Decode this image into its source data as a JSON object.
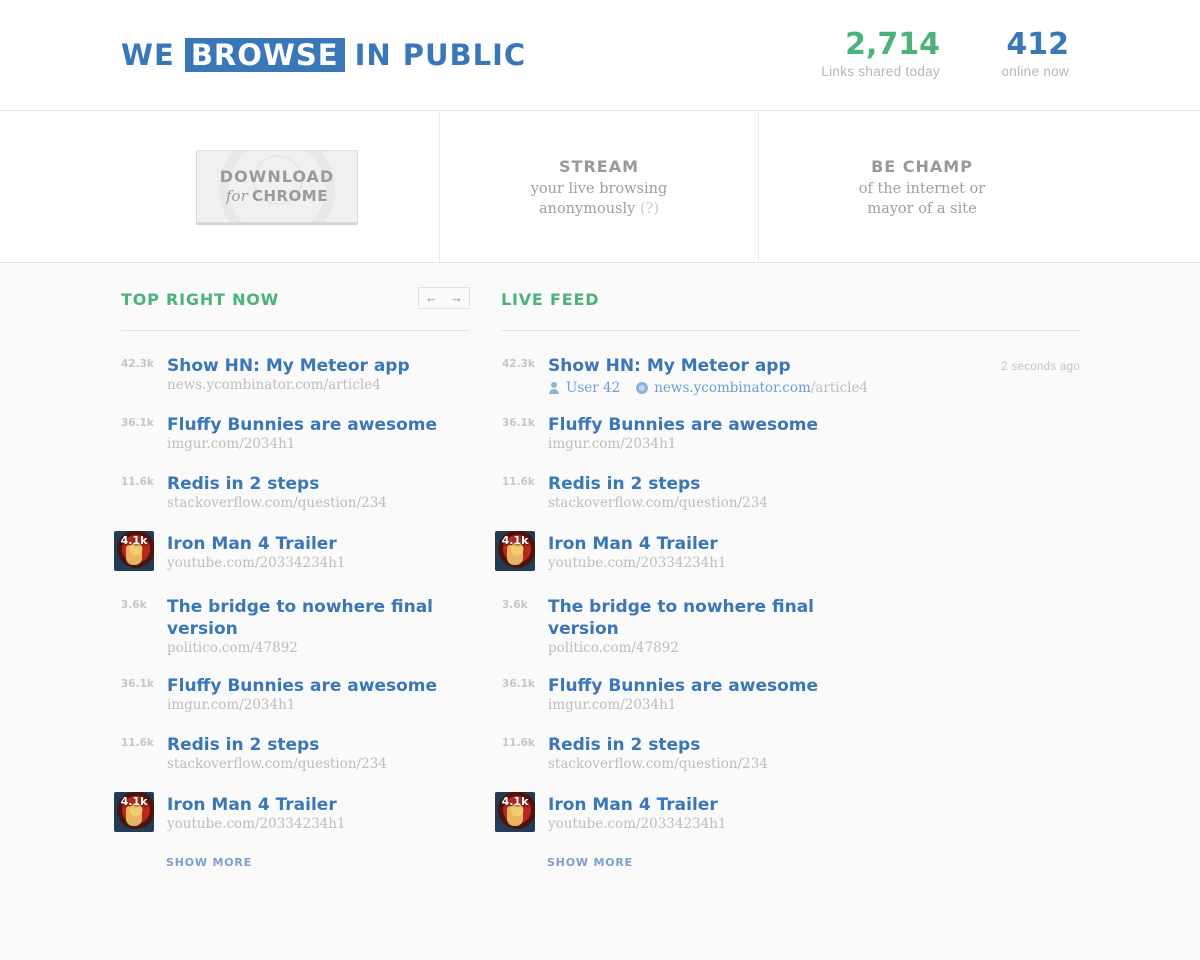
{
  "header": {
    "logo_pre": "WE",
    "logo_highlight": "BROWSE",
    "logo_post": "IN PUBLIC",
    "links_count": "2,714",
    "links_label": "Links shared today",
    "online_count": "412",
    "online_label": "online now"
  },
  "promo": {
    "download_line1": "DOWNLOAD",
    "download_for": "for",
    "download_chrome": "CHROME",
    "stream_title": "STREAM",
    "stream_line1": "your live browsing",
    "stream_line2": "anonymously",
    "stream_help": "(?)",
    "champ_title": "BE CHAMP",
    "champ_line1": "of the internet or",
    "champ_line2": "mayor of a site"
  },
  "top": {
    "title": "TOP RIGHT NOW",
    "prev_icon": "arrow-left-icon",
    "next_icon": "arrow-right-icon",
    "items": [
      {
        "count": "42.3k",
        "title": "Show HN: My Meteor app",
        "url": "news.ycombinator.com/article4",
        "thumb": false
      },
      {
        "count": "36.1k",
        "title": "Fluffy Bunnies are awesome",
        "url": "imgur.com/2034h1",
        "thumb": false
      },
      {
        "count": "11.6k",
        "title": "Redis in 2 steps",
        "url": "stackoverflow.com/question/234",
        "thumb": false
      },
      {
        "count": "4.1k",
        "title": "Iron Man 4 Trailer",
        "url": "youtube.com/20334234h1",
        "thumb": true
      },
      {
        "count": "3.6k",
        "title": "The bridge to nowhere final version",
        "url": "politico.com/47892",
        "thumb": false
      },
      {
        "count": "36.1k",
        "title": "Fluffy Bunnies are awesome",
        "url": "imgur.com/2034h1",
        "thumb": false
      },
      {
        "count": "11.6k",
        "title": "Redis in 2 steps",
        "url": "stackoverflow.com/question/234",
        "thumb": false
      },
      {
        "count": "4.1k",
        "title": "Iron Man 4 Trailer",
        "url": "youtube.com/20334234h1",
        "thumb": true
      }
    ],
    "show_more": "SHOW MORE"
  },
  "live": {
    "title": "LIVE FEED",
    "first_user": "User 42",
    "first_domain": "news.ycombinator.com",
    "first_path": "/article4",
    "first_time": "2 seconds ago",
    "items": [
      {
        "count": "42.3k",
        "title": "Show HN: My Meteor app",
        "url": "",
        "thumb": false
      },
      {
        "count": "36.1k",
        "title": "Fluffy Bunnies are awesome",
        "url": "imgur.com/2034h1",
        "thumb": false
      },
      {
        "count": "11.6k",
        "title": "Redis in 2 steps",
        "url": "stackoverflow.com/question/234",
        "thumb": false
      },
      {
        "count": "4.1k",
        "title": "Iron Man 4 Trailer",
        "url": "youtube.com/20334234h1",
        "thumb": true
      },
      {
        "count": "3.6k",
        "title": "The bridge to nowhere final version",
        "url": "politico.com/47892",
        "thumb": false
      },
      {
        "count": "36.1k",
        "title": "Fluffy Bunnies are awesome",
        "url": "imgur.com/2034h1",
        "thumb": false
      },
      {
        "count": "11.6k",
        "title": "Redis in 2 steps",
        "url": "stackoverflow.com/question/234",
        "thumb": false
      },
      {
        "count": "4.1k",
        "title": "Iron Man 4 Trailer",
        "url": "youtube.com/20334234h1",
        "thumb": true
      }
    ],
    "show_more": "SHOW MORE"
  }
}
